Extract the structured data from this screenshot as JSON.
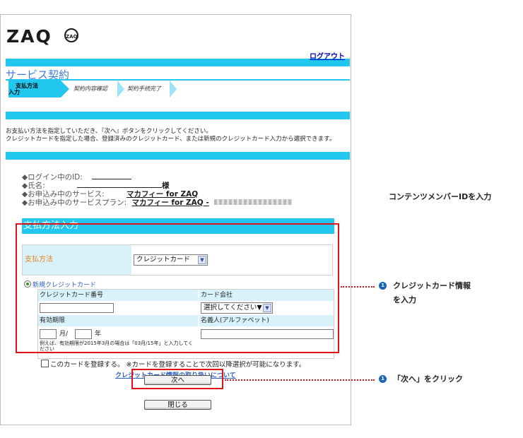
{
  "header": {
    "logo_text": "ZAQ",
    "logo_badge": "ZAQ",
    "logout_label": "ログアウト"
  },
  "page": {
    "title": "サービス契約",
    "steps": [
      "支払方法\n入力",
      "契約内容確認",
      "契約手続完了"
    ],
    "instructions": [
      "お支払い方法を指定していただき、『次へ』ボタンをクリックしてください。",
      "クレジットカードを指定した場合、登録済みのクレジットカード、または新規のクレジットカード入力から選択できます。"
    ]
  },
  "account_info": {
    "login_id_label": "◆ログイン中のID:",
    "login_id_value": "________",
    "name_label": "◆氏名:",
    "name_suffix": "様",
    "service_label": "◆お申込み中のサービス:",
    "service_value": "マカフィー for ZAQ",
    "plan_label": "◆お申込み中のサービスプラン:",
    "plan_value": "マカフィー for ZAQ -"
  },
  "payment": {
    "section_title": "支払方法入力",
    "method_label": "支払方法",
    "method_selected": "クレジットカード",
    "new_card_label": "新規クレジットカード",
    "card_number_label": "クレジットカード番号",
    "card_company_label": "カード会社",
    "card_company_selected": "選択してください▼",
    "expiry_label": "有効期限",
    "month_unit": "月/",
    "year_unit": "年",
    "expiry_note": "例えば、有効期限が2015年3月の場合は「03月/15年」と入力してください",
    "holder_label": "名義人(アルファベット)",
    "register_label": "このカードを登録する。 ※カードを登録することで次回以降選択が可能になります。",
    "handling_link": "クレジットカード情報の取り扱いについて"
  },
  "buttons": {
    "next": "次へ",
    "close": "閉じる"
  },
  "annotations": {
    "side_note": "コンテンツメンバーIDを入力",
    "card_info_line1": "クレジットカード情報",
    "card_info_line2": "を入力",
    "click_next": "「次へ」をクリック",
    "bullet": "1"
  },
  "colors": {
    "accent_cyan": "#22c7ef",
    "highlight_red": "#e0121a",
    "label_orange": "#e8830f",
    "link_blue": "#2b5fc0",
    "bullet_blue": "#1c64b4"
  }
}
